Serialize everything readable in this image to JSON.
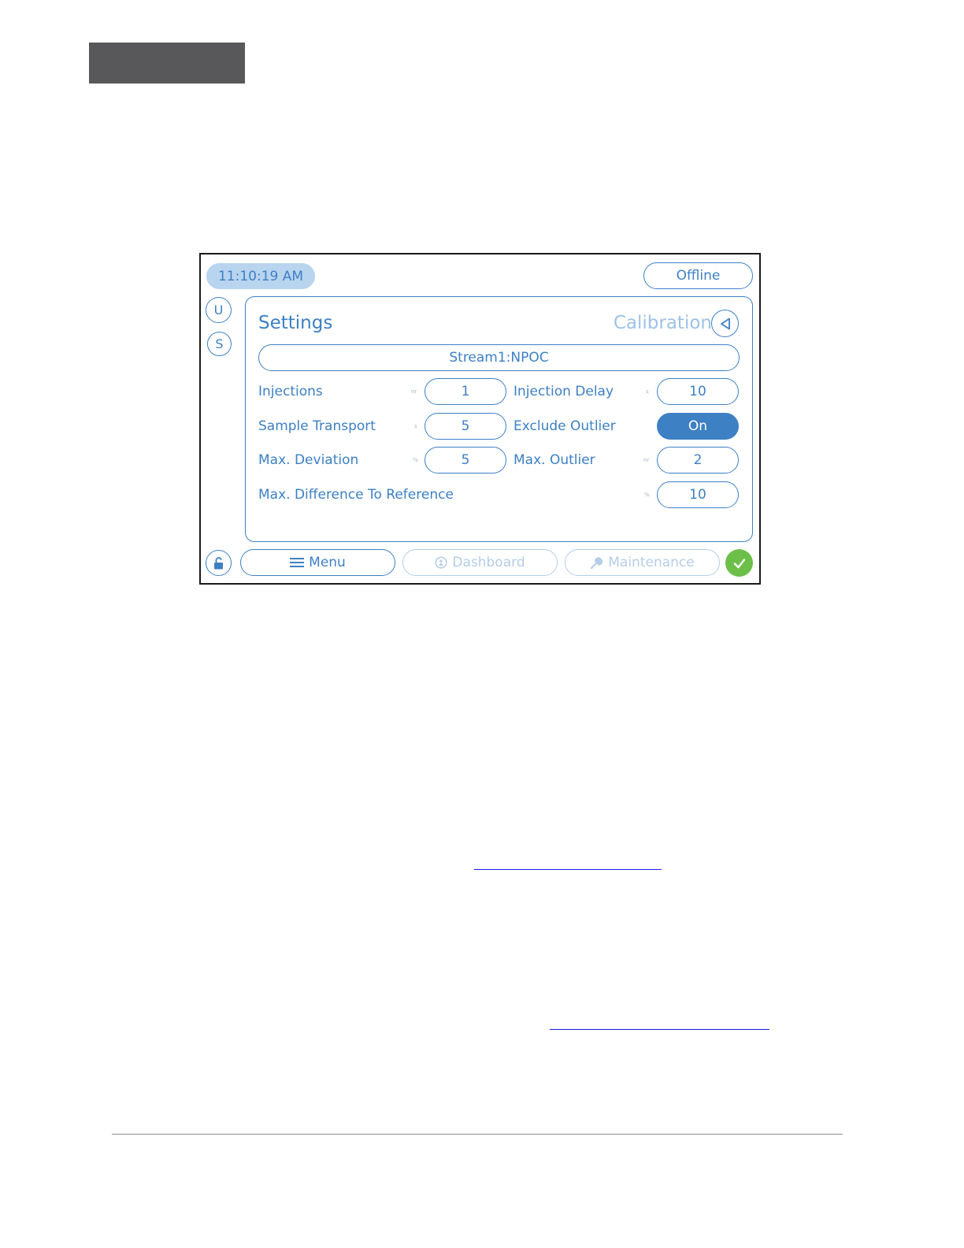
{
  "device": {
    "time": "11:10:19 AM",
    "status": "Offline",
    "side_buttons": {
      "u": "U",
      "s": "S"
    },
    "panel": {
      "title": "Settings",
      "breadcrumb": "Calibration",
      "stream": "Stream1:NPOC",
      "fields": {
        "injections": {
          "label": "Injections",
          "unit": "nr",
          "value": "1"
        },
        "injection_delay": {
          "label": "Injection Delay",
          "unit": "s",
          "value": "10"
        },
        "sample_transport": {
          "label": "Sample Transport",
          "unit": "s",
          "value": "5"
        },
        "exclude_outlier": {
          "label": "Exclude Outlier",
          "value": "On"
        },
        "max_deviation": {
          "label": "Max. Deviation",
          "unit": "%",
          "value": "5"
        },
        "max_outlier": {
          "label": "Max. Outlier",
          "unit": "nr",
          "value": "2"
        },
        "max_difference": {
          "label": "Max. Difference To Reference",
          "unit": "%",
          "value": "10"
        }
      }
    },
    "nav": {
      "menu": "Menu",
      "dashboard": "Dashboard",
      "maintenance": "Maintenance"
    },
    "icons": {
      "lock": "unlocked-padlock-icon",
      "back": "triangle-left-icon",
      "confirm": "checkmark-icon",
      "menu": "hamburger-icon",
      "dashboard": "gauge-icon",
      "maintenance": "wrench-icon"
    },
    "colors": {
      "accent": "#3d80c4",
      "time_bg": "#b9d4ef",
      "ok": "#6cc04a",
      "disabled": "#b4cde8"
    }
  }
}
